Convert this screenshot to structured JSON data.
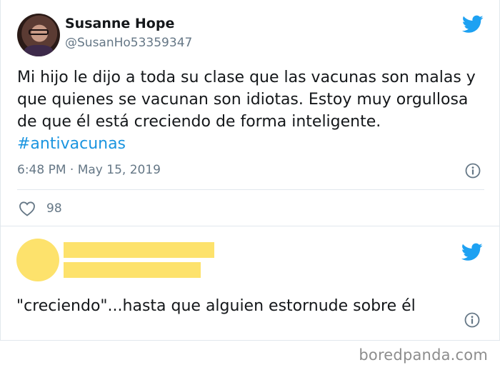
{
  "tweet": {
    "display_name": "Susanne Hope",
    "handle": "@SusanHo53359347",
    "text_lines": [
      "Mi hijo le dijo a toda su clase que las vacunas son malas y",
      "que quienes se vacunan son idiotas. Estoy muy orgullosa",
      "de que él está creciendo de forma inteligente."
    ],
    "hashtag": "#antivacunas",
    "timestamp": "6:48 PM · May 15, 2019",
    "like_count": "98"
  },
  "reply": {
    "text": "\"creciendo\"...hasta que alguien estornude sobre él"
  },
  "watermark": "boredpanda.com",
  "colors": {
    "text": "#14171a",
    "secondary": "#657786",
    "link": "#1b95e0",
    "twitter_blue": "#1da1f2",
    "redaction": "#fde26c",
    "divider": "#e1e8ed"
  },
  "icons": [
    "twitter-bird-icon",
    "info-icon",
    "heart-icon"
  ]
}
